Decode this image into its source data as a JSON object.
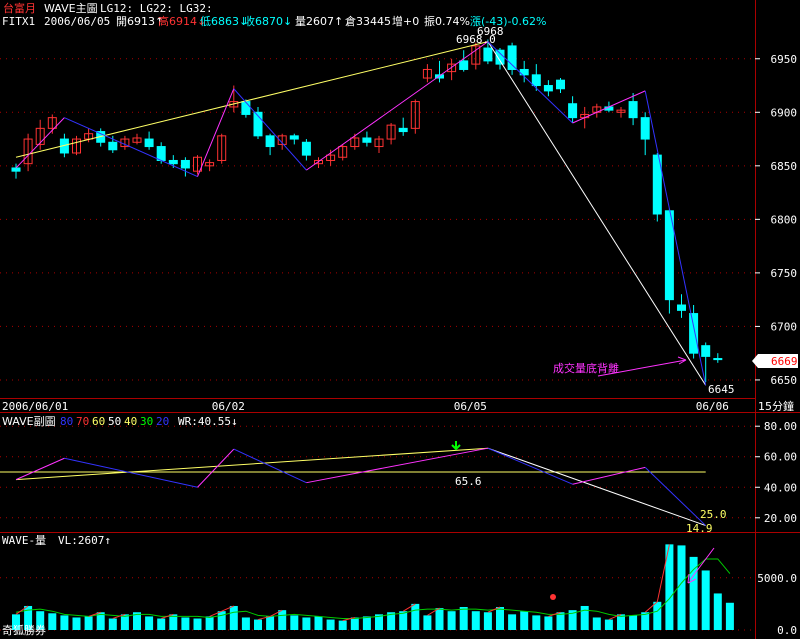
{
  "header": {
    "title": "台富月",
    "indicator": "WAVE主圖",
    "params": "LG12: LG22: LG32:",
    "symbol": "FITX1",
    "date": "2006/06/05",
    "open": "開6913↑",
    "high": "高6914↓",
    "low": "低6863↓",
    "close": "收6870↓",
    "volume": "量2607↑",
    "oi": "倉33445",
    "oi_change": "增+0",
    "amp": "振0.74%",
    "change": "漲(-43)-0.62%"
  },
  "colors": {
    "background": "#000000",
    "up_candle": "#ff3333",
    "down_candle": "#00ffff",
    "wave_up": "#ff33ff",
    "wave_down": "#3333ff",
    "trend": "#ffff66",
    "decline": "#ffffff",
    "grid": "#aa0000",
    "axis_text": "#ffffff",
    "volume_bar": "#00ffff",
    "volume_line": "#00cc00"
  },
  "footer": {
    "brand": "奇狐勝券",
    "interval": "15分鐘",
    "price_tag": "6669"
  },
  "chart_data": [
    {
      "type": "candlestick",
      "ylim": [
        6635,
        6975
      ],
      "y_ticks": [
        6650,
        6700,
        6750,
        6800,
        6850,
        6900,
        6950
      ],
      "x_labels": [
        "2006/06/01",
        "06/02",
        "06/05",
        "06/06"
      ],
      "x_label_bars": [
        0,
        18,
        38,
        58
      ],
      "annotations": {
        "peak": "6968.0",
        "peak_high": "6968",
        "low": "6645",
        "note": "成交量底背離"
      },
      "candles": [
        {
          "o": 6848,
          "h": 6852,
          "l": 6838,
          "c": 6845
        },
        {
          "o": 6852,
          "h": 6880,
          "l": 6845,
          "c": 6875
        },
        {
          "o": 6870,
          "h": 6893,
          "l": 6865,
          "c": 6885
        },
        {
          "o": 6885,
          "h": 6898,
          "l": 6880,
          "c": 6895
        },
        {
          "o": 6875,
          "h": 6880,
          "l": 6858,
          "c": 6862
        },
        {
          "o": 6862,
          "h": 6878,
          "l": 6860,
          "c": 6875
        },
        {
          "o": 6875,
          "h": 6885,
          "l": 6872,
          "c": 6880
        },
        {
          "o": 6882,
          "h": 6885,
          "l": 6868,
          "c": 6872
        },
        {
          "o": 6872,
          "h": 6878,
          "l": 6862,
          "c": 6865
        },
        {
          "o": 6868,
          "h": 6878,
          "l": 6865,
          "c": 6875
        },
        {
          "o": 6872,
          "h": 6880,
          "l": 6870,
          "c": 6876
        },
        {
          "o": 6875,
          "h": 6882,
          "l": 6865,
          "c": 6868
        },
        {
          "o": 6868,
          "h": 6872,
          "l": 6852,
          "c": 6855
        },
        {
          "o": 6855,
          "h": 6860,
          "l": 6848,
          "c": 6852
        },
        {
          "o": 6855,
          "h": 6858,
          "l": 6840,
          "c": 6848
        },
        {
          "o": 6845,
          "h": 6860,
          "l": 6842,
          "c": 6858
        },
        {
          "o": 6850,
          "h": 6856,
          "l": 6845,
          "c": 6853
        },
        {
          "o": 6855,
          "h": 6880,
          "l": 6852,
          "c": 6878
        },
        {
          "o": 6905,
          "h": 6925,
          "l": 6900,
          "c": 6910
        },
        {
          "o": 6910,
          "h": 6912,
          "l": 6895,
          "c": 6898
        },
        {
          "o": 6900,
          "h": 6905,
          "l": 6875,
          "c": 6878
        },
        {
          "o": 6878,
          "h": 6880,
          "l": 6860,
          "c": 6868
        },
        {
          "o": 6870,
          "h": 6880,
          "l": 6865,
          "c": 6878
        },
        {
          "o": 6878,
          "h": 6880,
          "l": 6870,
          "c": 6875
        },
        {
          "o": 6872,
          "h": 6875,
          "l": 6855,
          "c": 6860
        },
        {
          "o": 6852,
          "h": 6858,
          "l": 6848,
          "c": 6855
        },
        {
          "o": 6855,
          "h": 6865,
          "l": 6850,
          "c": 6860
        },
        {
          "o": 6858,
          "h": 6870,
          "l": 6855,
          "c": 6868
        },
        {
          "o": 6868,
          "h": 6880,
          "l": 6865,
          "c": 6876
        },
        {
          "o": 6876,
          "h": 6882,
          "l": 6868,
          "c": 6872
        },
        {
          "o": 6868,
          "h": 6878,
          "l": 6862,
          "c": 6875
        },
        {
          "o": 6875,
          "h": 6890,
          "l": 6870,
          "c": 6888
        },
        {
          "o": 6885,
          "h": 6895,
          "l": 6878,
          "c": 6882
        },
        {
          "o": 6885,
          "h": 6912,
          "l": 6880,
          "c": 6910
        },
        {
          "o": 6932,
          "h": 6945,
          "l": 6928,
          "c": 6940
        },
        {
          "o": 6935,
          "h": 6948,
          "l": 6928,
          "c": 6932
        },
        {
          "o": 6938,
          "h": 6950,
          "l": 6930,
          "c": 6945
        },
        {
          "o": 6948,
          "h": 6958,
          "l": 6938,
          "c": 6940
        },
        {
          "o": 6945,
          "h": 6965,
          "l": 6940,
          "c": 6962
        },
        {
          "o": 6960,
          "h": 6968,
          "l": 6945,
          "c": 6948
        },
        {
          "o": 6958,
          "h": 6960,
          "l": 6940,
          "c": 6945
        },
        {
          "o": 6962,
          "h": 6965,
          "l": 6935,
          "c": 6940
        },
        {
          "o": 6940,
          "h": 6948,
          "l": 6928,
          "c": 6935
        },
        {
          "o": 6935,
          "h": 6945,
          "l": 6920,
          "c": 6925
        },
        {
          "o": 6925,
          "h": 6930,
          "l": 6915,
          "c": 6920
        },
        {
          "o": 6930,
          "h": 6932,
          "l": 6918,
          "c": 6922
        },
        {
          "o": 6908,
          "h": 6915,
          "l": 6890,
          "c": 6895
        },
        {
          "o": 6895,
          "h": 6905,
          "l": 6885,
          "c": 6898
        },
        {
          "o": 6900,
          "h": 6908,
          "l": 6895,
          "c": 6905
        },
        {
          "o": 6905,
          "h": 6910,
          "l": 6900,
          "c": 6902
        },
        {
          "o": 6900,
          "h": 6905,
          "l": 6895,
          "c": 6902
        },
        {
          "o": 6910,
          "h": 6918,
          "l": 6888,
          "c": 6895
        },
        {
          "o": 6895,
          "h": 6900,
          "l": 6860,
          "c": 6875
        },
        {
          "o": 6860,
          "h": 6862,
          "l": 6798,
          "c": 6805
        },
        {
          "o": 6808,
          "h": 6810,
          "l": 6712,
          "c": 6725
        },
        {
          "o": 6720,
          "h": 6730,
          "l": 6708,
          "c": 6715
        },
        {
          "o": 6712,
          "h": 6720,
          "l": 6670,
          "c": 6675
        },
        {
          "o": 6682,
          "h": 6685,
          "l": 6648,
          "c": 6672
        },
        {
          "o": 6670,
          "h": 6675,
          "l": 6666,
          "c": 6669
        }
      ],
      "wave_points": [
        {
          "i": 0,
          "v": 6848
        },
        {
          "i": 4,
          "v": 6895
        },
        {
          "i": 15,
          "v": 6840
        },
        {
          "i": 18,
          "v": 6922
        },
        {
          "i": 24,
          "v": 6846
        },
        {
          "i": 39,
          "v": 6966
        },
        {
          "i": 46,
          "v": 6890
        },
        {
          "i": 52,
          "v": 6920
        },
        {
          "i": 57,
          "v": 6645
        }
      ],
      "trend_line": [
        {
          "i": 0,
          "v": 6858
        },
        {
          "i": 39,
          "v": 6966
        }
      ],
      "decline_line": [
        {
          "i": 39,
          "v": 6966
        },
        {
          "i": 57,
          "v": 6645
        }
      ]
    },
    {
      "type": "line",
      "title": "WAVE副圖",
      "levels_legend": [
        "80",
        "70",
        "60",
        "50",
        "40",
        "30",
        "20"
      ],
      "wr_label": "WR:40.55↓",
      "ylim": [
        12,
        88
      ],
      "y_ticks": [
        20,
        40,
        60,
        80
      ],
      "wave": [
        {
          "i": 0,
          "v": 45
        },
        {
          "i": 4,
          "v": 59
        },
        {
          "i": 15,
          "v": 40
        },
        {
          "i": 18,
          "v": 65
        },
        {
          "i": 24,
          "v": 43
        },
        {
          "i": 39,
          "v": 65.6
        },
        {
          "i": 46,
          "v": 42
        },
        {
          "i": 52,
          "v": 53
        },
        {
          "i": 57,
          "v": 14.9
        }
      ],
      "flat_line": 50,
      "trend_line": [
        {
          "i": 0,
          "v": 45
        },
        {
          "i": 39,
          "v": 65.6
        }
      ],
      "decline_line": [
        {
          "i": 39,
          "v": 65.6
        },
        {
          "i": 57,
          "v": 14.9
        }
      ],
      "annotations": {
        "peak": "65.6",
        "low": "14.9",
        "level": "25.0"
      }
    },
    {
      "type": "bar",
      "title": "WAVE-量",
      "vl_label": "VL:2607↑",
      "ylim": [
        0,
        9000
      ],
      "y_ticks": [
        0,
        5000
      ],
      "y_tick_labels": [
        "0.0",
        "5000.0"
      ],
      "values": [
        1500,
        2300,
        1800,
        1600,
        1400,
        1200,
        1300,
        1700,
        1100,
        1500,
        1700,
        1300,
        1100,
        1500,
        1200,
        1100,
        1300,
        1800,
        2300,
        1200,
        1000,
        1300,
        1900,
        1400,
        1200,
        1300,
        1000,
        900,
        1200,
        1300,
        1500,
        1700,
        1800,
        2500,
        1400,
        2100,
        1800,
        2200,
        1800,
        1700,
        2200,
        1500,
        1800,
        1400,
        1300,
        1700,
        1900,
        2300,
        1200,
        1000,
        1500,
        1400,
        1700,
        2700,
        8200,
        8100,
        7000,
        5700,
        3500,
        2607
      ],
      "ma_line": [
        1700,
        1900,
        2000,
        1800,
        1500,
        1400,
        1300,
        1500,
        1400,
        1300,
        1500,
        1500,
        1300,
        1300,
        1300,
        1300,
        1200,
        1400,
        1700,
        1800,
        1400,
        1300,
        1400,
        1500,
        1400,
        1300,
        1200,
        1100,
        1100,
        1200,
        1300,
        1500,
        1600,
        1900,
        2000,
        2000,
        1900,
        2000,
        2000,
        1900,
        2000,
        1900,
        1800,
        1700,
        1500,
        1500,
        1600,
        1900,
        1800,
        1500,
        1300,
        1400,
        1500,
        1800,
        3000,
        4500,
        5800,
        6800,
        6800,
        5400
      ]
    }
  ]
}
